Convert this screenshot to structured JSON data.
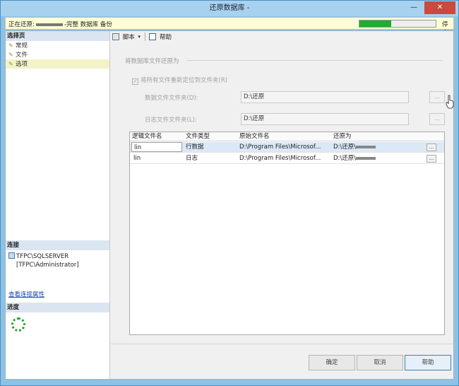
{
  "window": {
    "title": "还原数据库 -",
    "minimize_glyph": "—",
    "close_glyph": "✕"
  },
  "status": {
    "prefix": "正在还原:",
    "suffix": "-完整 数据库 备份",
    "progress_fraction": 0.42,
    "stop_label": "停止"
  },
  "sidebar": {
    "header": "选择页",
    "items": [
      {
        "label": "常规",
        "icon": "page-icon"
      },
      {
        "label": "文件",
        "icon": "page-icon"
      },
      {
        "label": "选项",
        "icon": "page-icon"
      }
    ],
    "connection_header": "连接",
    "server": "TFPC\\SQLSERVER",
    "user": "[TFPC\\Administrator]",
    "view_connection_link": "查看连接属性",
    "progress_header": "进度"
  },
  "toolbar": {
    "script_label": "脚本",
    "help_label": "帮助"
  },
  "files": {
    "group_label": "将数据库文件还原为",
    "relocate_label": "将所有文件重新定位到文件夹(R)",
    "data_folder_label": "数据文件文件夹(D):",
    "data_folder_value": "D:\\还原",
    "log_folder_label": "日志文件文件夹(L):",
    "log_folder_value": "D:\\还原",
    "browse_label": "...",
    "columns": [
      "逻辑文件名",
      "文件类型",
      "原始文件名",
      "还原为"
    ],
    "rows": [
      {
        "logical": "lin",
        "type": "行数据",
        "original": "D:\\Program Files\\Microsof...",
        "restore_as": "D:\\还原\\"
      },
      {
        "logical": "lin",
        "type": "日志",
        "original": "D:\\Program Files\\Microsof...",
        "restore_as": "D:\\还原\\"
      }
    ]
  },
  "footer": {
    "ok_label": "确定",
    "cancel_label": "取消",
    "help_label": "帮助"
  }
}
